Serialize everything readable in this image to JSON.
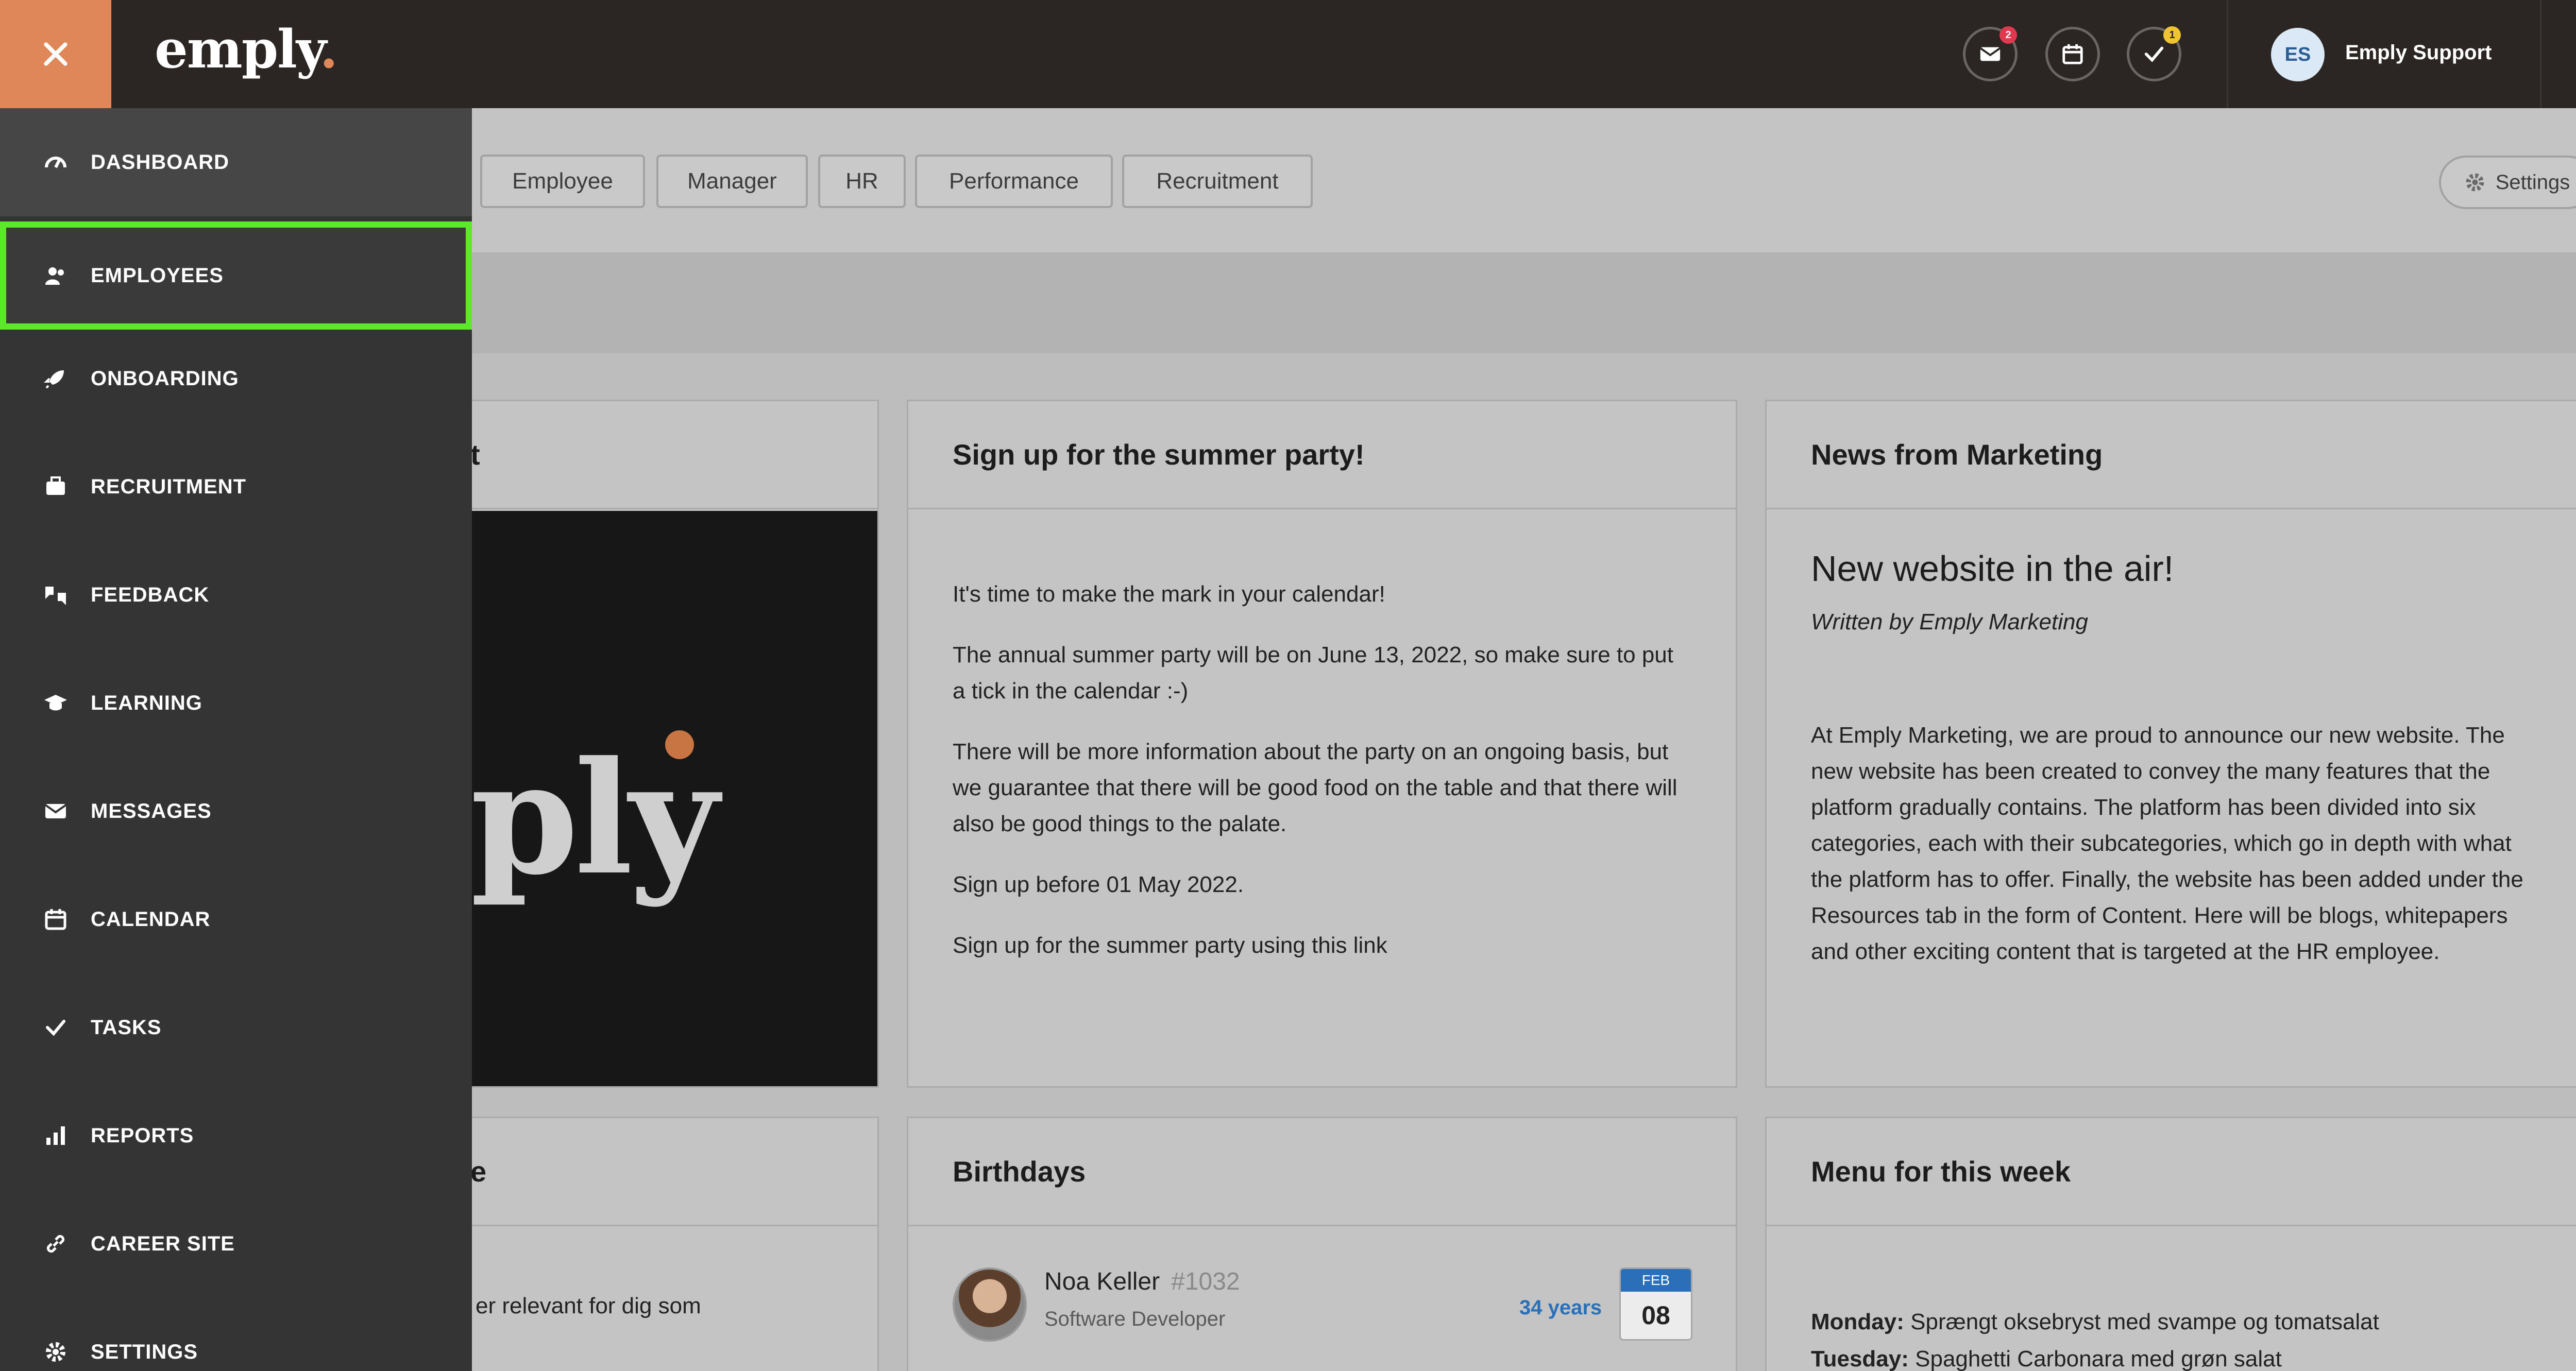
{
  "app": {
    "logo": "emply",
    "logo_dot": "."
  },
  "header": {
    "badges": {
      "messages": "2",
      "tasks": "1"
    },
    "user": {
      "initials": "ES",
      "name": "Emply Support"
    }
  },
  "sidebar": {
    "items": [
      {
        "label": "DASHBOARD",
        "icon": "dashboard-icon"
      },
      {
        "label": "EMPLOYEES",
        "icon": "employees-icon"
      },
      {
        "label": "ONBOARDING",
        "icon": "rocket-icon"
      },
      {
        "label": "RECRUITMENT",
        "icon": "briefcase-icon"
      },
      {
        "label": "FEEDBACK",
        "icon": "feedback-icon"
      },
      {
        "label": "LEARNING",
        "icon": "graduation-cap-icon"
      },
      {
        "label": "MESSAGES",
        "icon": "envelope-icon"
      },
      {
        "label": "CALENDAR",
        "icon": "calendar-icon"
      },
      {
        "label": "TASKS",
        "icon": "check-icon"
      },
      {
        "label": "REPORTS",
        "icon": "bar-chart-icon"
      },
      {
        "label": "CAREER SITE",
        "icon": "link-icon"
      },
      {
        "label": "SETTINGS",
        "icon": "gear-icon"
      }
    ]
  },
  "toolbar": {
    "filters": [
      "Employee",
      "Manager",
      "HR",
      "Performance",
      "Recruitment"
    ],
    "settings_label": "Settings"
  },
  "cards": {
    "partial_left_top": {
      "title_fragment": "t",
      "image_text": "ply"
    },
    "summer_party": {
      "title": "Sign up for the summer party!",
      "paragraphs": [
        "It's time to make the mark in your calendar!",
        "The annual summer party will be on June 13, 2022, so make sure to put a tick in the calendar :-)",
        "There will be more information about the party on an ongoing basis, but we guarantee that there will be good food on the table and that there will also be good things to the palate.",
        "Sign up before 01 May 2022.",
        "Sign up for the summer party using this link"
      ]
    },
    "news": {
      "title": "News from Marketing",
      "headline": "New website in the air!",
      "author": "Written by Emply Marketing",
      "body": "At Emply Marketing, we are proud to announce our new website. The new website has been created to convey the many features that the platform gradually contains. The platform has been divided into six categories, each with their subcategories, which go in depth with what the platform has to offer. Finally, the website has been added under the Resources tab in the form of Content. Here will be blogs, whitepapers and other exciting content that is targeted at the HR employee."
    },
    "partial_left_bottom": {
      "title_fragment": "e",
      "text_fragment": "er relevant for dig som"
    },
    "birthdays": {
      "title": "Birthdays",
      "person": {
        "name": "Noa Keller",
        "id": "#1032",
        "role": "Software Developer",
        "age": "34 years",
        "month": "FEB",
        "day": "08"
      }
    },
    "menu": {
      "title": "Menu for this week",
      "lines": [
        {
          "day": "Monday:",
          "dish": "Sprængt oksebryst med svampe og tomatsalat"
        },
        {
          "day": "Tuesday:",
          "dish": "Spaghetti Carbonara med grøn salat"
        }
      ]
    }
  },
  "colors": {
    "accent": "#e0875a",
    "topbar": "#2b2623",
    "sidebar": "#343434",
    "highlight": "#5ee82b",
    "link_blue": "#2a6fb8"
  }
}
